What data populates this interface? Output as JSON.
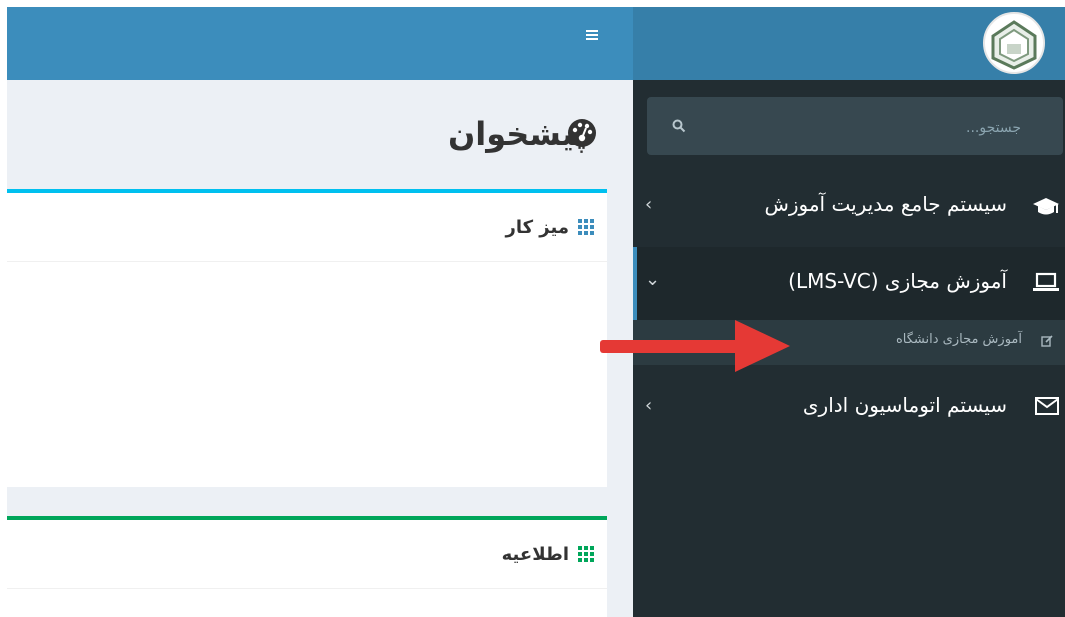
{
  "header": {
    "menu_toggle_icon": "hamburger-icon",
    "brand_color": "#3c8dbc"
  },
  "sidebar": {
    "search": {
      "placeholder": "جستجو..."
    },
    "items": [
      {
        "label": "سیستم جامع مدیریت آموزش",
        "icon": "graduation-cap-icon",
        "caret": "‹",
        "expanded": false
      },
      {
        "label": "آموزش مجازی (LMS-VC)",
        "icon": "laptop-icon",
        "caret": "⌄",
        "expanded": true,
        "children": [
          {
            "label": "آموزش مجازی دانشگاه",
            "icon": "edit-icon"
          }
        ]
      },
      {
        "label": "سیستم اتوماسیون اداری",
        "icon": "envelope-icon",
        "caret": "‹",
        "expanded": false
      }
    ]
  },
  "main": {
    "page_title": "پیشخوان",
    "page_title_icon": "dashboard-icon",
    "boxes": [
      {
        "title": "میز کار",
        "icon": "grid-icon",
        "accent": "#00c0ef"
      },
      {
        "title": "اطلاعیه",
        "icon": "grid-icon",
        "accent": "#00a65a"
      }
    ]
  },
  "annotation": {
    "icon": "red-arrow-icon",
    "color": "#e53935"
  }
}
